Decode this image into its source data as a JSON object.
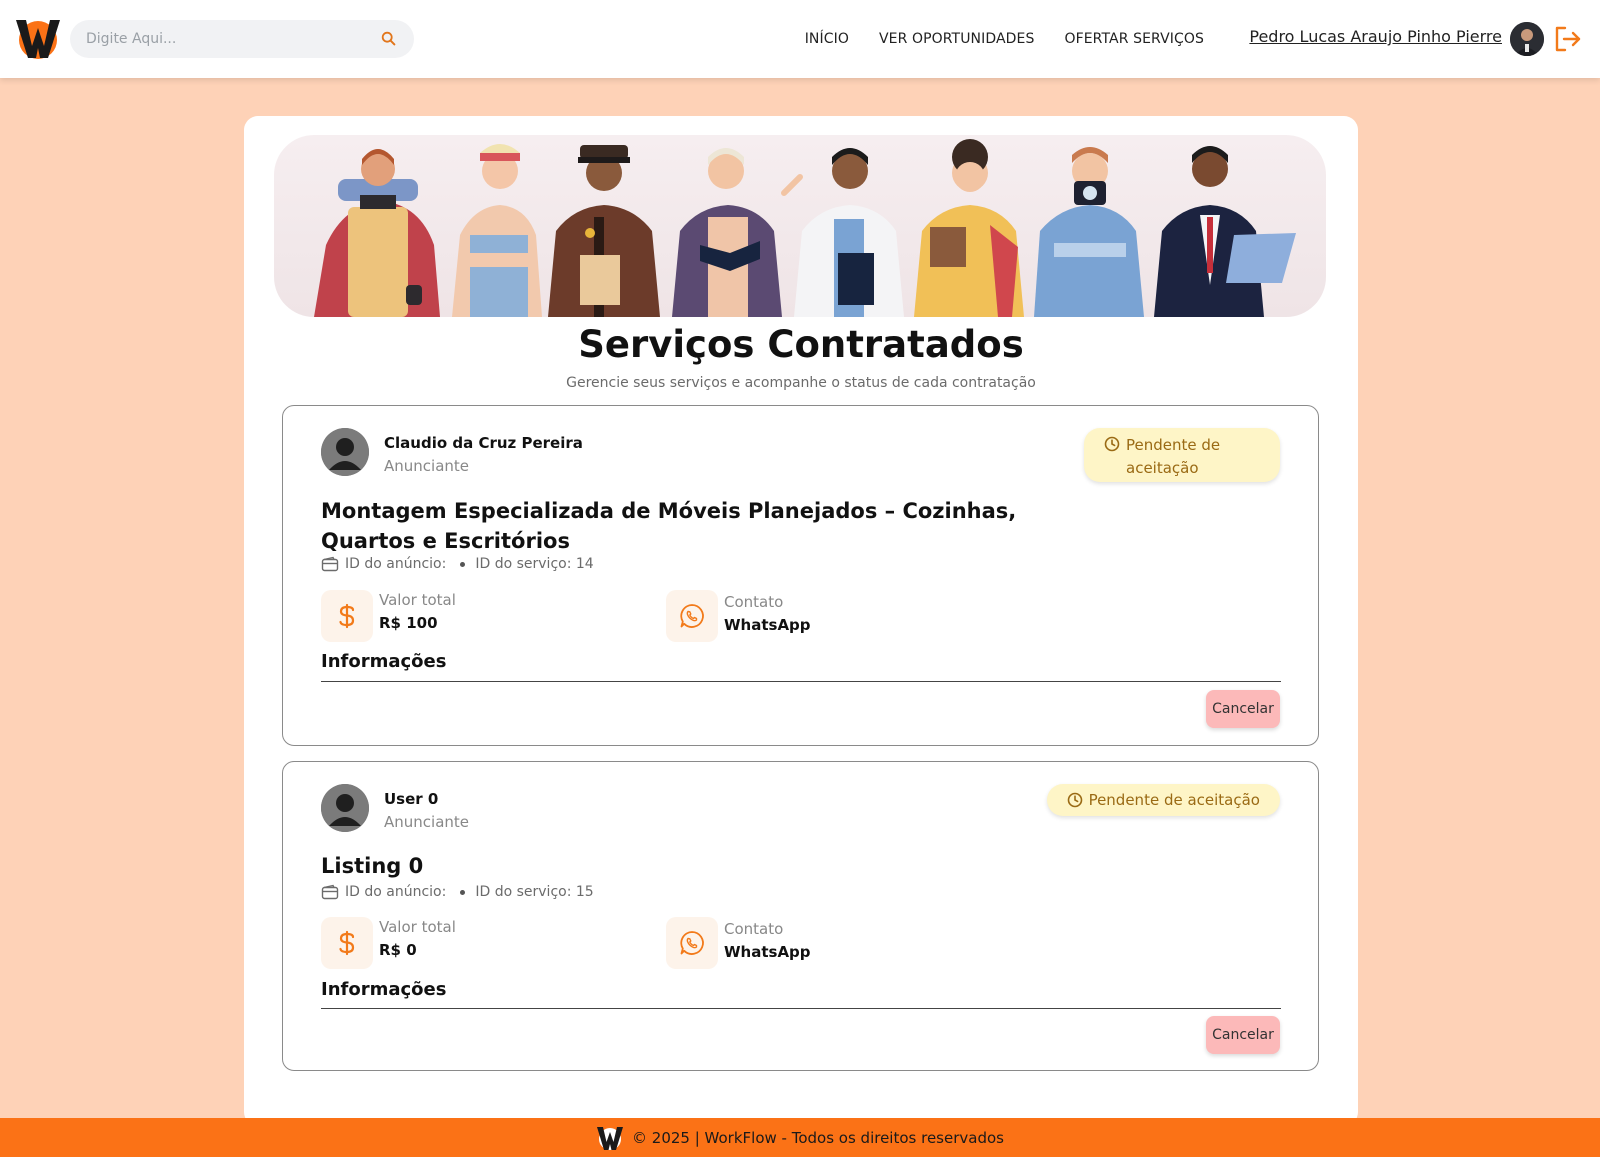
{
  "header": {
    "search_placeholder": "Digite Aqui...",
    "nav": [
      "INÍCIO",
      "VER OPORTUNIDADES",
      "OFERTAR SERVIÇOS"
    ],
    "user_name": "Pedro Lucas Araujo Pinho Pierre"
  },
  "page": {
    "title": "Serviços Contratados",
    "subtitle": "Gerencie seus serviços e acompanhe o status de cada contratação"
  },
  "services": [
    {
      "advertiser_name": "Claudio da Cruz Pereira",
      "advertiser_role": "Anunciante",
      "status": "Pendente de aceitação",
      "title": "Montagem Especializada de Móveis Planejados – Cozinhas, Quartos e Escritórios",
      "listing_id_label": "ID do anúncio:",
      "service_id_label": "ID do serviço: 14",
      "total_label": "Valor total",
      "total_value": "R$ 100",
      "contact_label": "Contato",
      "contact_value": "WhatsApp",
      "info_title": "Informações",
      "cancel_label": "Cancelar"
    },
    {
      "advertiser_name": "User 0",
      "advertiser_role": "Anunciante",
      "status": "Pendente de aceitação",
      "title": "Listing 0",
      "listing_id_label": "ID do anúncio:",
      "service_id_label": "ID do serviço: 15",
      "total_label": "Valor total",
      "total_value": "R$ 0",
      "contact_label": "Contato",
      "contact_value": "WhatsApp",
      "info_title": "Informações",
      "cancel_label": "Cancelar"
    }
  ],
  "footer": {
    "text": "© 2025 | WorkFlow - Todos os direitos reservados"
  },
  "colors": {
    "page_background": "#fed2b7",
    "accent_orange": "#fb7216",
    "status_bg": "#fef5c7",
    "status_text": "#9a6a14",
    "cancel_bg": "#fcb9b9"
  },
  "icons": [
    "workflow-logo",
    "search-icon",
    "logout-icon",
    "user-avatar",
    "clock-icon",
    "wallet-icon",
    "dollar-icon",
    "whatsapp-icon"
  ]
}
